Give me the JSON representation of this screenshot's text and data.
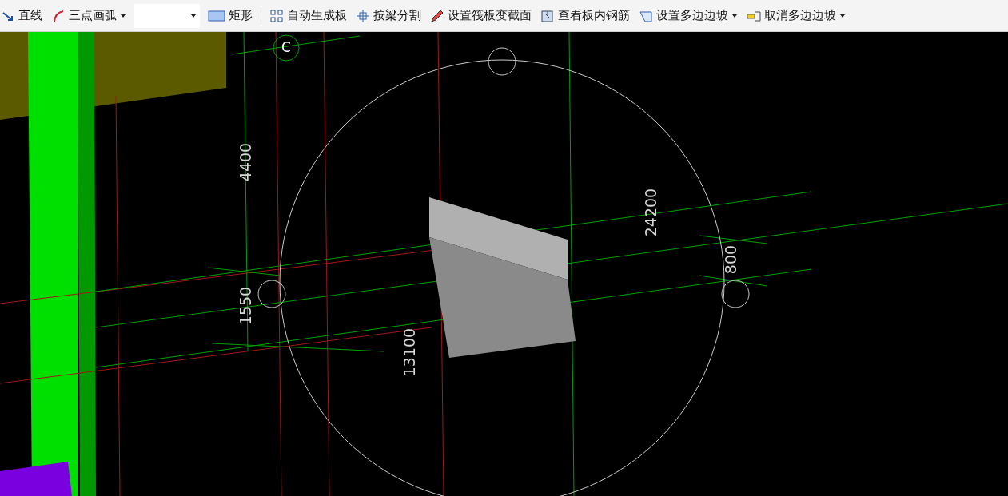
{
  "toolbar": {
    "items": [
      {
        "kind": "tool",
        "label": "直线",
        "dropdown": false
      },
      {
        "kind": "tool",
        "label": "三点画弧",
        "dropdown": true
      },
      {
        "kind": "combo"
      },
      {
        "kind": "tool",
        "label": "矩形",
        "dropdown": false
      },
      {
        "kind": "separator"
      },
      {
        "kind": "tool",
        "label": "自动生成板",
        "dropdown": false
      },
      {
        "kind": "tool",
        "label": "按梁分割",
        "dropdown": false
      },
      {
        "kind": "tool",
        "label": "设置筏板变截面",
        "dropdown": false
      },
      {
        "kind": "tool",
        "label": "查看板内钢筋",
        "dropdown": false
      },
      {
        "kind": "tool",
        "label": "设置多边边坡",
        "dropdown": true
      },
      {
        "kind": "tool",
        "label": "取消多边边坡",
        "dropdown": true
      }
    ]
  },
  "canvas": {
    "labels": [
      {
        "kind": "axis",
        "text": "C"
      },
      {
        "kind": "dimension",
        "text": "4400"
      },
      {
        "kind": "dimension",
        "text": "24200"
      },
      {
        "kind": "dimension",
        "text": "800"
      },
      {
        "kind": "dimension",
        "text": "1550"
      },
      {
        "kind": "dimension",
        "text": "13100"
      }
    ]
  }
}
